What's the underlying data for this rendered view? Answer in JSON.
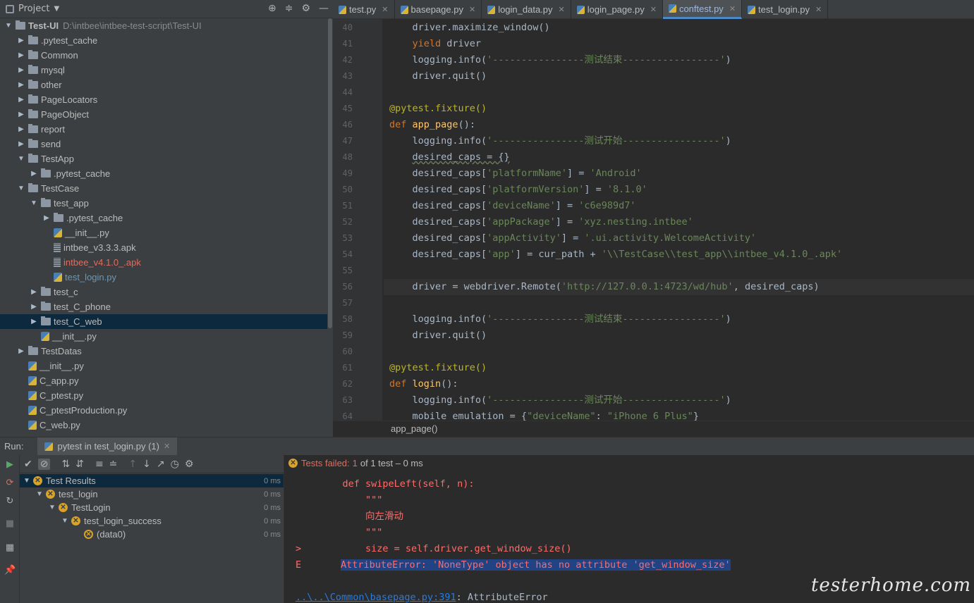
{
  "project": {
    "header_label": "Project",
    "root_name": "Test-UI",
    "root_path": "D:\\intbee\\intbee-test-script\\Test-UI",
    "tree": [
      {
        "label": "Test-UI",
        "depth": 0,
        "type": "folder",
        "expanded": true
      },
      {
        "label": ".pytest_cache",
        "depth": 1,
        "type": "folder",
        "expanded": false
      },
      {
        "label": "Common",
        "depth": 1,
        "type": "folder",
        "expanded": false
      },
      {
        "label": "mysql",
        "depth": 1,
        "type": "folder",
        "expanded": false
      },
      {
        "label": "other",
        "depth": 1,
        "type": "folder",
        "expanded": false
      },
      {
        "label": "PageLocators",
        "depth": 1,
        "type": "folder",
        "expanded": false
      },
      {
        "label": "PageObject",
        "depth": 1,
        "type": "folder",
        "expanded": false
      },
      {
        "label": "report",
        "depth": 1,
        "type": "folder",
        "expanded": false
      },
      {
        "label": "send",
        "depth": 1,
        "type": "folder",
        "expanded": false
      },
      {
        "label": "TestApp",
        "depth": 1,
        "type": "folder",
        "expanded": true
      },
      {
        "label": ".pytest_cache",
        "depth": 2,
        "type": "folder",
        "expanded": false
      },
      {
        "label": "TestCase",
        "depth": 1,
        "type": "folder",
        "expanded": true
      },
      {
        "label": "test_app",
        "depth": 2,
        "type": "folder",
        "expanded": true
      },
      {
        "label": ".pytest_cache",
        "depth": 3,
        "type": "folder",
        "expanded": false
      },
      {
        "label": "__init__.py",
        "depth": 3,
        "type": "py"
      },
      {
        "label": "intbee_v3.3.3.apk",
        "depth": 3,
        "type": "apk"
      },
      {
        "label": "intbee_v4.1.0_.apk",
        "depth": 3,
        "type": "apk",
        "color": "#e06c5e"
      },
      {
        "label": "test_login.py",
        "depth": 3,
        "type": "py",
        "color": "#6897bb"
      },
      {
        "label": "test_c",
        "depth": 2,
        "type": "folder",
        "expanded": false
      },
      {
        "label": "test_C_phone",
        "depth": 2,
        "type": "folder",
        "expanded": false
      },
      {
        "label": "test_C_web",
        "depth": 2,
        "type": "folder",
        "expanded": false,
        "selected": true
      },
      {
        "label": "__init__.py",
        "depth": 2,
        "type": "py"
      },
      {
        "label": "TestDatas",
        "depth": 1,
        "type": "folder",
        "expanded": false
      },
      {
        "label": "__init__.py",
        "depth": 1,
        "type": "py"
      },
      {
        "label": "C_app.py",
        "depth": 1,
        "type": "py"
      },
      {
        "label": "C_ptest.py",
        "depth": 1,
        "type": "py"
      },
      {
        "label": "C_ptestProduction.py",
        "depth": 1,
        "type": "py"
      },
      {
        "label": "C_web.py",
        "depth": 1,
        "type": "py"
      }
    ]
  },
  "tabs": [
    {
      "label": "test.py",
      "active": false
    },
    {
      "label": "basepage.py",
      "active": false
    },
    {
      "label": "login_data.py",
      "active": false
    },
    {
      "label": "login_page.py",
      "active": false
    },
    {
      "label": "conftest.py",
      "active": true
    },
    {
      "label": "test_login.py",
      "active": false
    }
  ],
  "editor": {
    "current_line": 56,
    "lines": [
      {
        "n": "40",
        "html": "    driver.maximize_window()"
      },
      {
        "n": "41",
        "html": "    <span class='kw'>yield</span> driver"
      },
      {
        "n": "42",
        "html": "    logging.info(<span class='str'>'----------------测试结束-----------------'</span>)"
      },
      {
        "n": "43",
        "html": "    driver.quit()"
      },
      {
        "n": "44",
        "html": ""
      },
      {
        "n": "45",
        "html": "<span class='deco'>@pytest.fixture()</span>"
      },
      {
        "n": "46",
        "html": "<span class='kw'>def</span> <span class='fn'>app_page</span>():"
      },
      {
        "n": "47",
        "html": "    logging.info(<span class='str'>'----------------测试开始-----------------'</span>)"
      },
      {
        "n": "48",
        "html": "    <span class='und'>desired_caps = {}</span>"
      },
      {
        "n": "49",
        "html": "    desired_caps[<span class='str'>'platformName'</span>] = <span class='str'>'Android'</span>"
      },
      {
        "n": "50",
        "html": "    desired_caps[<span class='str'>'platformVersion'</span>] = <span class='str'>'8.1.0'</span>"
      },
      {
        "n": "51",
        "html": "    desired_caps[<span class='str'>'deviceName'</span>] = <span class='str'>'c6e989d7'</span>"
      },
      {
        "n": "52",
        "html": "    desired_caps[<span class='str'>'appPackage'</span>] = <span class='str'>'xyz.nesting.intbee'</span>"
      },
      {
        "n": "53",
        "html": "    desired_caps[<span class='str'>'appActivity'</span>] = <span class='str'>'.ui.activity.WelcomeActivity'</span>"
      },
      {
        "n": "54",
        "html": "    desired_caps[<span class='str'>'app'</span>] = cur_path + <span class='str'>'\\\\TestCase\\\\test_app\\\\intbee_v4.1.0_.apk'</span>"
      },
      {
        "n": "55",
        "html": ""
      },
      {
        "n": "56",
        "html": "    driver = webdriver.Remote(<span class='str'>'http://127.0.0.1:4723/wd/hub'</span>, desired_caps)"
      },
      {
        "n": "57",
        "html": ""
      },
      {
        "n": "58",
        "html": "    logging.info(<span class='str'>'----------------测试结束-----------------'</span>)"
      },
      {
        "n": "59",
        "html": "    driver.quit()"
      },
      {
        "n": "60",
        "html": ""
      },
      {
        "n": "61",
        "html": "<span class='deco'>@pytest.fixture()</span>"
      },
      {
        "n": "62",
        "html": "<span class='kw'>def</span> <span class='fn'>login</span>():"
      },
      {
        "n": "63",
        "html": "    logging.info(<span class='str'>'----------------测试开始-----------------'</span>)"
      },
      {
        "n": "64",
        "html": "    mobile_emulation = {<span class='str'>\"deviceName\"</span>: <span class='str'>\"iPhone 6 Plus\"</span>}"
      }
    ]
  },
  "breadcrumb": "app_page()",
  "run": {
    "label": "Run:",
    "tab_label": "pytest in test_login.py (1)",
    "status_prefix": "Tests failed:",
    "status_count": "1",
    "status_suffix": "of 1 test – 0 ms",
    "results": [
      {
        "label": "Test Results",
        "depth": 0,
        "ms": "0 ms",
        "selected": true
      },
      {
        "label": "test_login",
        "depth": 1,
        "ms": "0 ms"
      },
      {
        "label": "TestLogin",
        "depth": 2,
        "ms": "0 ms"
      },
      {
        "label": "test_login_success",
        "depth": 3,
        "ms": "0 ms"
      },
      {
        "label": "(data0)",
        "depth": 4,
        "ms": "0 ms"
      }
    ],
    "console": [
      {
        "prefix": "",
        "text": "    def swipeLeft(self, n):"
      },
      {
        "prefix": "",
        "text": "        \"\"\""
      },
      {
        "prefix": "",
        "text": "        向左滑动"
      },
      {
        "prefix": "",
        "text": "        \"\"\""
      },
      {
        "prefix": ">",
        "text": "        size = self.driver.get_window_size()"
      },
      {
        "prefix": "E",
        "text": "AttributeError: 'NoneType' object has no attribute 'get_window_size'",
        "highlight": true
      },
      {
        "prefix": "",
        "text": ""
      },
      {
        "prefix": "",
        "link": "..\\..\\Common\\basepage.py:391",
        "text": ": AttributeError"
      }
    ]
  },
  "watermark": "testerhome.com"
}
